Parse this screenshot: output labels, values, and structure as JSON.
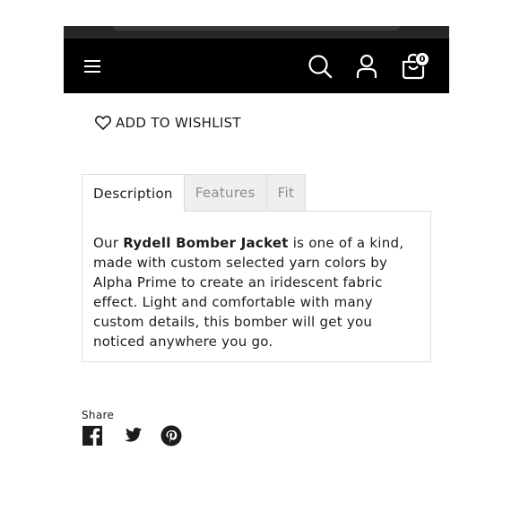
{
  "header": {
    "menu_icon": "hamburger-menu-icon",
    "search_icon": "search-icon",
    "account_icon": "user-account-icon",
    "cart_icon": "shopping-bag-icon",
    "cart_count": "0",
    "background": "#000000"
  },
  "wishlist": {
    "icon": "heart-icon",
    "label": "ADD TO WISHLIST"
  },
  "tabs": [
    {
      "label": "Description",
      "active": true
    },
    {
      "label": "Features",
      "active": false
    },
    {
      "label": "Fit",
      "active": false
    }
  ],
  "description": {
    "lead": "Our ",
    "product_name": "Rydell Bomber Jacket",
    "body": " is one of a kind, made with custom selected yarn colors by Alpha Prime to create an iridescent fabric effect. Light and comfortable with many custom details, this bomber will get you noticed anywhere you go."
  },
  "share": {
    "label": "Share",
    "icons": [
      "facebook-icon",
      "twitter-icon",
      "pinterest-icon"
    ]
  }
}
